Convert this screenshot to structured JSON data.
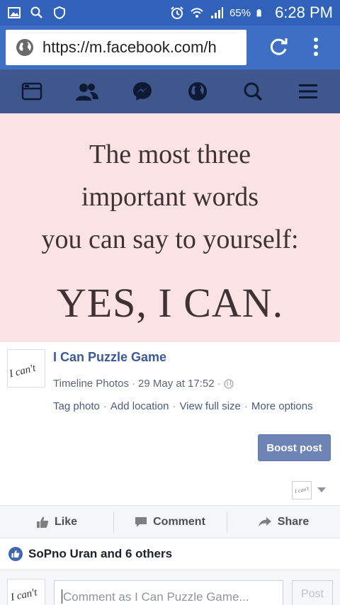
{
  "status_bar": {
    "battery_percent": "65%",
    "time": "6:28 PM",
    "left_icons": [
      "gallery-icon",
      "search-icon",
      "vpn-icon"
    ],
    "right_icons": [
      "alarm-icon",
      "wifi-icon",
      "signal-icon",
      "battery-icon"
    ]
  },
  "browser": {
    "url": "https://m.facebook.com/h",
    "reload_icon": "reload-icon",
    "menu_icon": "overflow-menu-icon"
  },
  "fb_nav": {
    "items": [
      "news-feed-icon",
      "friends-icon",
      "messenger-icon",
      "globe-icon",
      "search-icon",
      "menu-icon"
    ]
  },
  "quote": {
    "line1": "The most three",
    "line2": "important words",
    "line3": "you can say to yourself:",
    "line4": "YES, I CAN."
  },
  "post": {
    "avatar_text": "I can't",
    "page_name": "I Can Puzzle Game",
    "album": "Timeline Photos",
    "date": "29 May at 17:52",
    "links": [
      "Tag photo",
      "Add location",
      "View full size",
      "More options"
    ],
    "boost_label": "Boost post"
  },
  "actions": {
    "like": "Like",
    "comment": "Comment",
    "share": "Share"
  },
  "reactions": {
    "text": "SoPno Uran and 6 others"
  },
  "composer": {
    "avatar_text": "I can't",
    "placeholder": "Comment as I Can Puzzle Game...",
    "post_label": "Post"
  },
  "colors": {
    "status_bar": "#2f62b8",
    "address_bar": "#3d6fc4",
    "fb_nav": "#40578d",
    "quote_bg": "#fbe3e5",
    "link_blue": "#3b5998",
    "boost_button": "#6d84b4"
  }
}
